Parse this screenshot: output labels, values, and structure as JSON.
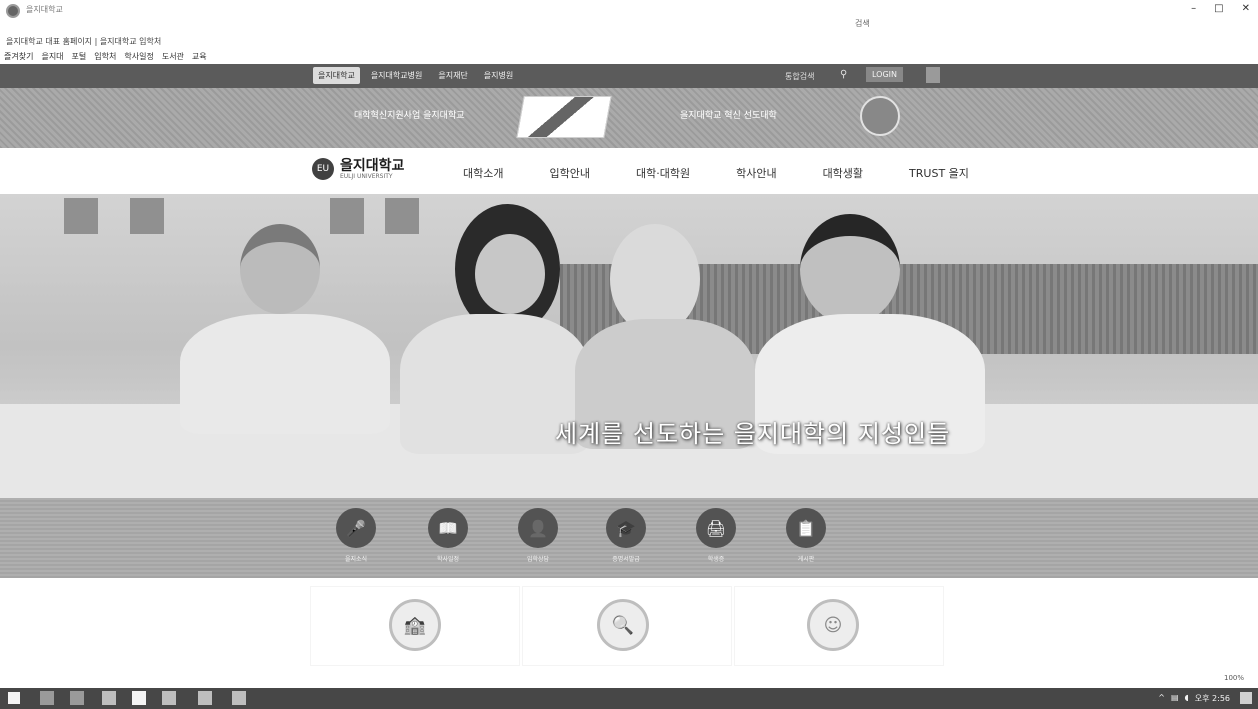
{
  "browser": {
    "title": "을지대학교",
    "address": "을지대학교 대표 홈페이지 | 을지대학교 입학처",
    "search_hint": "검색",
    "window_controls": [
      "–",
      "□",
      "✕"
    ],
    "favorites": [
      "즐겨찾기",
      "을지대",
      "포털",
      "입학처",
      "학사일정",
      "도서관",
      "교육"
    ]
  },
  "site_top": {
    "tabs": [
      "을지대학교",
      "을지대학교병원",
      "을지재단",
      "을지병원"
    ],
    "search_label": "통합검색",
    "login_label": "LOGIN"
  },
  "banner": {
    "text1": "대학혁신지원사업 을지대학교",
    "text2": "을지대학교 혁신 선도대학"
  },
  "nav": {
    "logo_mark": "EU",
    "logo_name": "을지대학교",
    "logo_sub": "EULJI UNIVERSITY",
    "menu": [
      "대학소개",
      "입학안내",
      "대학·대학원",
      "학사안내",
      "대학생활",
      "TRUST 을지"
    ]
  },
  "hero": {
    "caption": "세계를 선도하는 을지대학의 지성인들"
  },
  "quick_links": [
    {
      "icon": "microphone-icon",
      "glyph": "🎤",
      "label": "을지소식"
    },
    {
      "icon": "book-icon",
      "glyph": "📖",
      "label": "학사일정"
    },
    {
      "icon": "person-icon",
      "glyph": "👤",
      "label": "입학상담"
    },
    {
      "icon": "graduate-icon",
      "glyph": "🎓",
      "label": "증명서발급"
    },
    {
      "icon": "printer-icon",
      "glyph": "🖨",
      "label": "학생증"
    },
    {
      "icon": "board-icon",
      "glyph": "📋",
      "label": "게시판"
    }
  ],
  "features": [
    {
      "icon": "school-icon",
      "glyph": "🏫"
    },
    {
      "icon": "search-icon",
      "glyph": "🔍"
    },
    {
      "icon": "smile-icon",
      "glyph": "☺"
    }
  ],
  "zoom": "100%",
  "taskbar": {
    "time": "오후 2:56"
  }
}
